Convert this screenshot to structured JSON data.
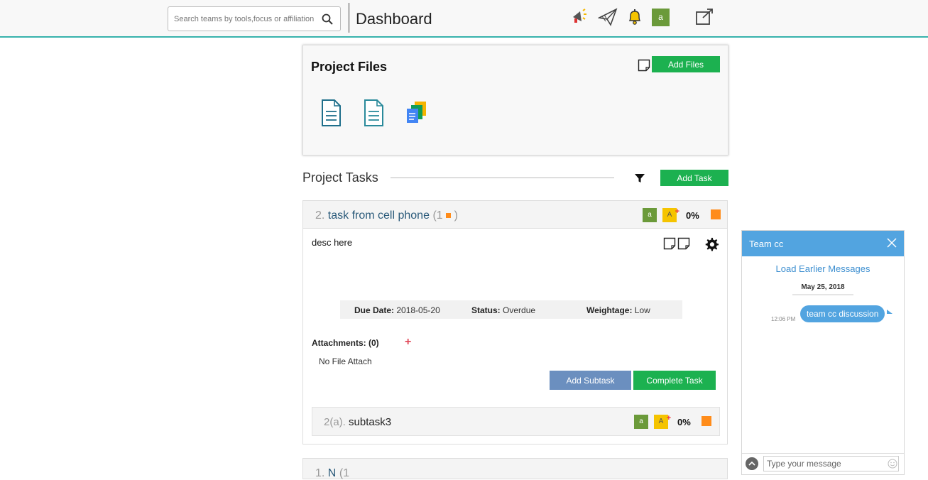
{
  "header": {
    "search_placeholder": "Search teams by tools,focus or affiliation",
    "title": "Dashboard",
    "avatar_letter": "a"
  },
  "project_files": {
    "title": "Project Files",
    "add_button": "Add Files"
  },
  "project_tasks": {
    "title": "Project Tasks",
    "add_button": "Add Task"
  },
  "task": {
    "number": "2.",
    "title": "task from cell phone",
    "count_open": "(1",
    "count_close": ")",
    "assignee_a": "a",
    "assignee_A": "A",
    "percent": "0%",
    "description": "desc here",
    "due_label": "Due Date:",
    "due_value": "2018-05-20",
    "status_label": "Status:",
    "status_value": "Overdue",
    "weight_label": "Weightage:",
    "weight_value": "Low",
    "attachments_label": "Attachments: (0)",
    "no_file": "No File Attach",
    "add_subtask": "Add Subtask",
    "complete_task": "Complete Task"
  },
  "subtask": {
    "number": "2(a).",
    "title": "subtask3",
    "assignee_a": "a",
    "assignee_A": "A",
    "percent": "0%"
  },
  "next_task": {
    "number": "1.",
    "title": "N",
    "count": "(1"
  },
  "chat": {
    "title": "Team cc",
    "load_earlier": "Load Earlier Messages",
    "date": "May 25, 2018",
    "time": "12:06 PM",
    "message": "team cc discussion",
    "input_placeholder": "Type your message"
  },
  "colors": {
    "accent_green": "#1cb150",
    "chat_blue": "#52a4e0",
    "status_orange": "#ff8c1a"
  }
}
